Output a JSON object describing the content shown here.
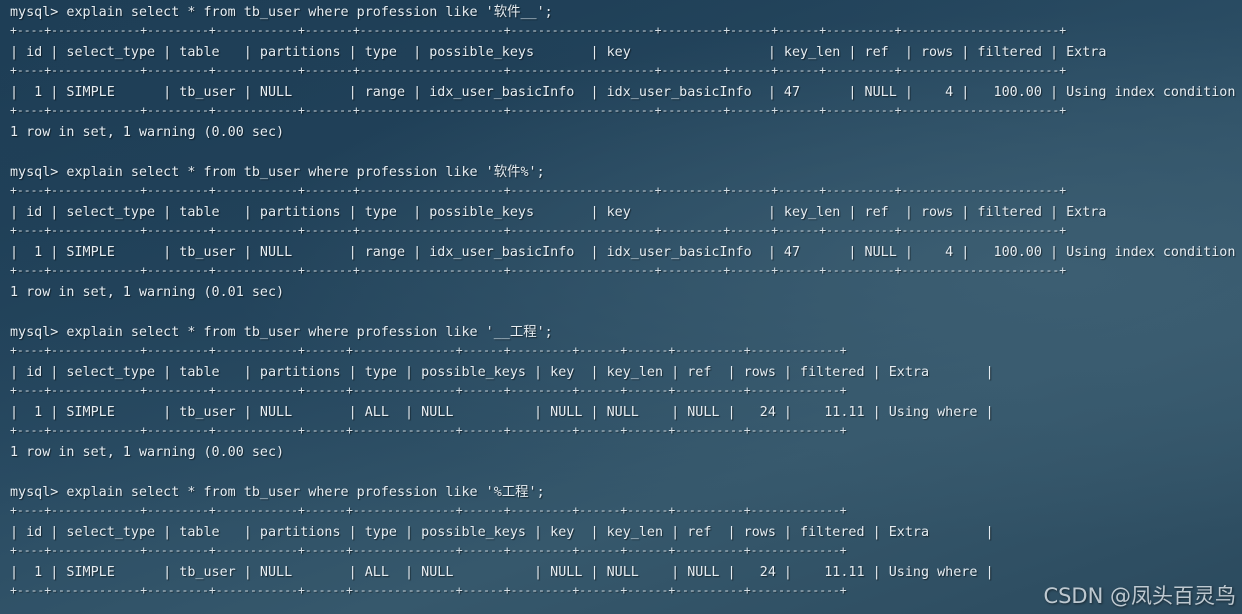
{
  "terminal": {
    "queries": [
      {
        "prompt": "mysql> explain select * from tb_user where profession like '软件__';",
        "border": "+----+-------------+---------+------------+-------+---------------------+---------------------+---------+------+------+----------+-----------------------+",
        "header": "| id | select_type | table   | partitions | type  | possible_keys       | key                 | key_len | ref  | rows | filtered | Extra                 |",
        "rows": [
          "|  1 | SIMPLE      | tb_user | NULL       | range | idx_user_basicInfo  | idx_user_basicInfo  | 47      | NULL |    4 |   100.00 | Using index condition |"
        ],
        "footer": "1 row in set, 1 warning (0.00 sec)"
      },
      {
        "prompt": "mysql> explain select * from tb_user where profession like '软件%';",
        "border": "+----+-------------+---------+------------+-------+---------------------+---------------------+---------+------+------+----------+-----------------------+",
        "header": "| id | select_type | table   | partitions | type  | possible_keys       | key                 | key_len | ref  | rows | filtered | Extra                 |",
        "rows": [
          "|  1 | SIMPLE      | tb_user | NULL       | range | idx_user_basicInfo  | idx_user_basicInfo  | 47      | NULL |    4 |   100.00 | Using index condition |"
        ],
        "footer": "1 row in set, 1 warning (0.01 sec)"
      },
      {
        "prompt": "mysql> explain select * from tb_user where profession like '__工程';",
        "border": "+----+-------------+---------+------------+------+---------------+------+---------+------+------+----------+-------------+",
        "header": "| id | select_type | table   | partitions | type | possible_keys | key  | key_len | ref  | rows | filtered | Extra       |",
        "rows": [
          "|  1 | SIMPLE      | tb_user | NULL       | ALL  | NULL          | NULL | NULL    | NULL |   24 |    11.11 | Using where |"
        ],
        "footer": "1 row in set, 1 warning (0.00 sec)"
      },
      {
        "prompt": "mysql> explain select * from tb_user where profession like '%工程';",
        "border": "+----+-------------+---------+------------+------+---------------+------+---------+------+------+----------+-------------+",
        "header": "| id | select_type | table   | partitions | type | possible_keys | key  | key_len | ref  | rows | filtered | Extra       |",
        "rows": [
          "|  1 | SIMPLE      | tb_user | NULL       | ALL  | NULL          | NULL | NULL    | NULL |   24 |    11.11 | Using where |"
        ],
        "footer": ""
      }
    ]
  },
  "watermark": "CSDN @凤头百灵鸟"
}
